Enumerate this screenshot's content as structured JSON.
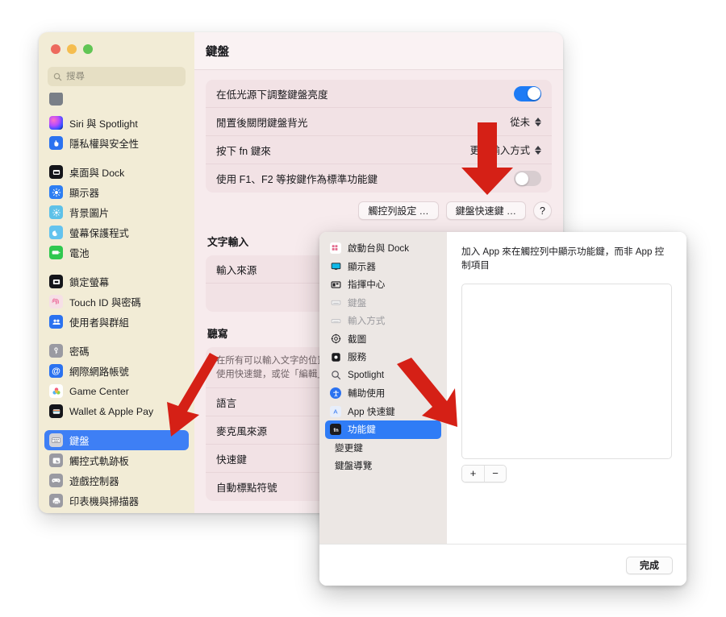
{
  "window": {
    "title": "鍵盤",
    "traffic_lights": [
      "close",
      "minimize",
      "zoom"
    ],
    "search": {
      "placeholder": "搜尋",
      "value": ""
    }
  },
  "sidebar": {
    "items": [
      {
        "label": "Siri 與 Spotlight",
        "icon": "siri-icon",
        "selected": false,
        "gap_before": false
      },
      {
        "label": "隱私權與安全性",
        "icon": "privacy-hand-icon",
        "selected": false,
        "gap_before": false
      },
      {
        "label": "桌面與 Dock",
        "icon": "desktop-dock-icon",
        "selected": false,
        "gap_before": true
      },
      {
        "label": "顯示器",
        "icon": "displays-icon",
        "selected": false,
        "gap_before": false
      },
      {
        "label": "背景圖片",
        "icon": "wallpaper-icon",
        "selected": false,
        "gap_before": false
      },
      {
        "label": "螢幕保護程式",
        "icon": "screensaver-icon",
        "selected": false,
        "gap_before": false
      },
      {
        "label": "電池",
        "icon": "battery-icon",
        "selected": false,
        "gap_before": false
      },
      {
        "label": "鎖定螢幕",
        "icon": "lock-screen-icon",
        "selected": false,
        "gap_before": true
      },
      {
        "label": "Touch ID 與密碼",
        "icon": "touch-id-icon",
        "selected": false,
        "gap_before": false
      },
      {
        "label": "使用者與群組",
        "icon": "users-groups-icon",
        "selected": false,
        "gap_before": false
      },
      {
        "label": "密碼",
        "icon": "passwords-key-icon",
        "selected": false,
        "gap_before": true
      },
      {
        "label": "網際網路帳號",
        "icon": "internet-accounts-icon",
        "selected": false,
        "gap_before": false
      },
      {
        "label": "Game Center",
        "icon": "game-center-icon",
        "selected": false,
        "gap_before": false
      },
      {
        "label": "Wallet & Apple Pay",
        "icon": "wallet-icon",
        "selected": false,
        "gap_before": false
      },
      {
        "label": "鍵盤",
        "icon": "keyboard-icon",
        "selected": true,
        "gap_before": true
      },
      {
        "label": "觸控式軌跡板",
        "icon": "trackpad-icon",
        "selected": false,
        "gap_before": false
      },
      {
        "label": "遊戲控制器",
        "icon": "game-controller-icon",
        "selected": false,
        "gap_before": false
      },
      {
        "label": "印表機與掃描器",
        "icon": "printers-scanners-icon",
        "selected": false,
        "gap_before": false
      }
    ]
  },
  "keyboard_pane": {
    "rows": [
      {
        "label": "在低光源下調整鍵盤亮度",
        "control": "toggle",
        "state": "on"
      },
      {
        "label": "閒置後關閉鍵盤背光",
        "control": "popup",
        "value": "從未"
      },
      {
        "label": "按下 fn 鍵來",
        "control": "popup",
        "value": "更改輸入方式"
      },
      {
        "label": "使用 F1、F2 等按鍵作為標準功能鍵",
        "control": "toggle",
        "state": "off"
      }
    ],
    "buttons": {
      "touch_bar": "觸控列設定 …",
      "shortcuts": "鍵盤快速鍵 …",
      "help": "?"
    },
    "text_input": {
      "heading": "文字輸入",
      "rows": [
        {
          "label": "輸入來源"
        }
      ]
    },
    "dictation": {
      "heading": "聽寫",
      "description_line1": "在所有可以輸入文字的位置",
      "description_line2": "使用快速鍵，或從「編輯」",
      "rows": [
        {
          "label": "語言"
        },
        {
          "label": "麥克風來源"
        },
        {
          "label": "快速鍵"
        },
        {
          "label": "自動標點符號"
        }
      ]
    }
  },
  "shortcuts_modal": {
    "categories": [
      {
        "label": "啟動台與 Dock",
        "icon": "launchpad-dock-icon",
        "selected": false,
        "dim": false
      },
      {
        "label": "顯示器",
        "icon": "display-icon",
        "selected": false,
        "dim": false
      },
      {
        "label": "指揮中心",
        "icon": "mission-control-icon",
        "selected": false,
        "dim": false
      },
      {
        "label": "鍵盤",
        "icon": "keyboard-icon",
        "selected": false,
        "dim": true
      },
      {
        "label": "輸入方式",
        "icon": "input-sources-icon",
        "selected": false,
        "dim": true
      },
      {
        "label": "截圖",
        "icon": "screenshot-icon",
        "selected": false,
        "dim": false
      },
      {
        "label": "服務",
        "icon": "services-icon",
        "selected": false,
        "dim": false
      },
      {
        "label": "Spotlight",
        "icon": "spotlight-search-icon",
        "selected": false,
        "dim": false
      },
      {
        "label": "輔助使用",
        "icon": "accessibility-icon",
        "selected": false,
        "dim": false
      },
      {
        "label": "App 快速鍵",
        "icon": "app-shortcuts-icon",
        "selected": false,
        "dim": false
      },
      {
        "label": "功能鍵",
        "icon": "fn-function-keys-icon",
        "selected": true,
        "dim": false
      },
      {
        "label": "變更鍵",
        "icon": "none",
        "selected": false,
        "dim": false
      },
      {
        "label": "鍵盤導覽",
        "icon": "none",
        "selected": false,
        "dim": false
      }
    ],
    "pane_description": "加入 App 來在觸控列中顯示功能鍵，而非 App 控制項目",
    "add_button": "+",
    "remove_button": "−",
    "done_button": "完成"
  },
  "annotations": {
    "arrow_color": "#d52016",
    "arrows": [
      {
        "name": "arrow-to-keyboard-sidebar-item"
      },
      {
        "name": "arrow-to-keyboard-shortcuts-button"
      },
      {
        "name": "arrow-to-function-keys-category"
      }
    ]
  },
  "colors": {
    "sidebar_bg": "#f2ecd6",
    "content_bg": "#f7ebed",
    "card_bg": "#f2e2e5",
    "accent_blue": "#3e7ff5",
    "modal_sidebar_bg": "#ece7e4",
    "arrow_red": "#d52016"
  }
}
